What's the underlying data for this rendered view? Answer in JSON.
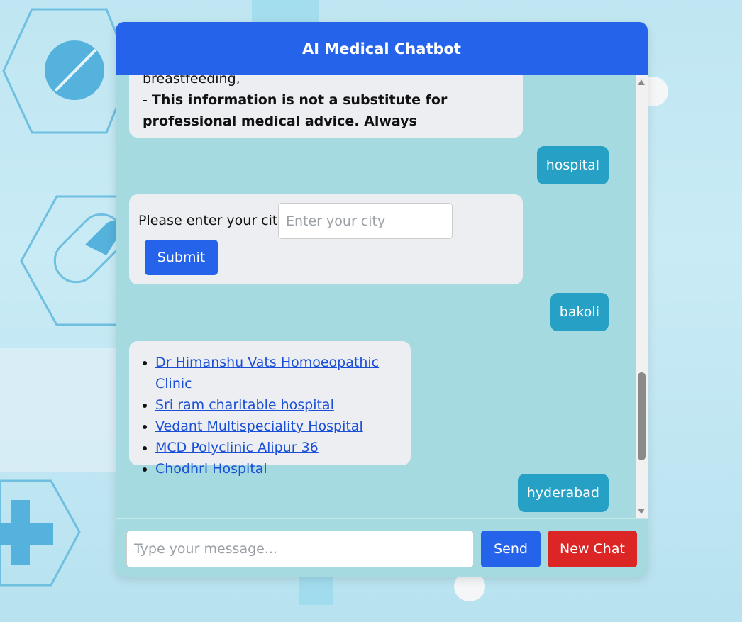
{
  "header": {
    "title": "AI Medical Chatbot"
  },
  "messages": {
    "info": {
      "line1": "breastfeeding,",
      "prefix": "- ",
      "bold": "This information is not a substitute for professional medical advice. Always"
    },
    "user1": "hospital",
    "city_form": {
      "label": "Please enter your city:",
      "placeholder": "Enter your city",
      "submit_label": "Submit"
    },
    "user2": "bakoli",
    "hospitals": [
      "Dr Himanshu Vats Homoeopathic Clinic",
      "Sri ram charitable hospital",
      "Vedant Multispeciality Hospital",
      "MCD Polyclinic Alipur 36",
      "Chodhri Hospital"
    ],
    "user3": "hyderabad"
  },
  "input_bar": {
    "placeholder": "Type your message...",
    "send_label": "Send",
    "new_chat_label": "New Chat"
  },
  "colors": {
    "header": "#2563eb",
    "chat_bg": "#a5dbe0",
    "user_bubble": "#26a0c5",
    "bot_bubble": "#eceef2",
    "new_chat": "#dc2626"
  }
}
